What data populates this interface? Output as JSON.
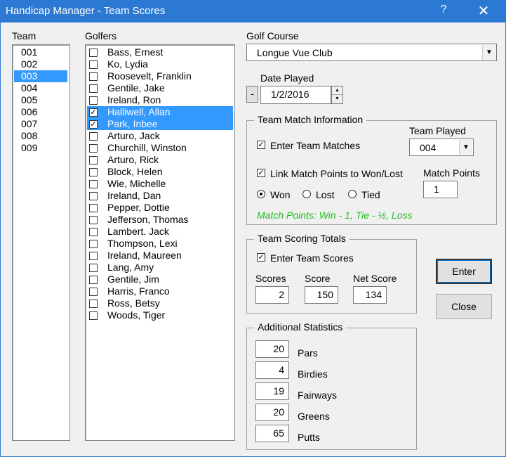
{
  "window": {
    "title": "Handicap Manager - Team Scores",
    "help": "?",
    "close": "✕"
  },
  "team": {
    "label": "Team",
    "items": [
      "001",
      "002",
      "003",
      "004",
      "005",
      "006",
      "007",
      "008",
      "009"
    ],
    "selected": "003"
  },
  "golfers": {
    "label": "Golfers",
    "items": [
      {
        "name": "Bass, Ernest",
        "checked": false
      },
      {
        "name": "Ko, Lydia",
        "checked": false
      },
      {
        "name": "Roosevelt, Franklin",
        "checked": false
      },
      {
        "name": "Gentile, Jake",
        "checked": false
      },
      {
        "name": "Ireland, Ron",
        "checked": false
      },
      {
        "name": "Halliwell, Allan",
        "checked": true
      },
      {
        "name": "Park, Inbee",
        "checked": true
      },
      {
        "name": "Arturo, Jack",
        "checked": false
      },
      {
        "name": "Churchill, Winston",
        "checked": false
      },
      {
        "name": "Arturo, Rick",
        "checked": false
      },
      {
        "name": "Block, Helen",
        "checked": false
      },
      {
        "name": "Wie, Michelle",
        "checked": false
      },
      {
        "name": "Ireland, Dan",
        "checked": false
      },
      {
        "name": "Pepper, Dottie",
        "checked": false
      },
      {
        "name": "Jefferson, Thomas",
        "checked": false
      },
      {
        "name": "Lambert. Jack",
        "checked": false
      },
      {
        "name": "Thompson, Lexi",
        "checked": false
      },
      {
        "name": "Ireland, Maureen",
        "checked": false
      },
      {
        "name": "Lang, Amy",
        "checked": false
      },
      {
        "name": "Gentile, Jim",
        "checked": false
      },
      {
        "name": "Harris, Franco",
        "checked": false
      },
      {
        "name": "Ross, Betsy",
        "checked": false
      },
      {
        "name": "Woods, Tiger",
        "checked": false
      }
    ]
  },
  "golf_course": {
    "label": "Golf Course",
    "value": "Longue Vue Club"
  },
  "date_played": {
    "label": "Date Played",
    "value": "1/2/2016",
    "minus": "-"
  },
  "team_match": {
    "title": "Team Match Information",
    "enter_matches_label": "Enter Team Matches",
    "enter_matches_checked": true,
    "team_played_label": "Team Played",
    "team_played_value": "004",
    "link_points_label": "Link Match Points to Won/Lost",
    "link_points_checked": true,
    "match_points_label": "Match Points",
    "match_points_value": "1",
    "result_options": [
      "Won",
      "Lost",
      "Tied"
    ],
    "result_selected": "Won",
    "note": "Match Points:  Win - 1, Tie - ½, Loss"
  },
  "team_scoring": {
    "title": "Team Scoring Totals",
    "enter_scores_label": "Enter Team Scores",
    "enter_scores_checked": true,
    "scores_label": "Scores",
    "scores_value": "2",
    "score_label": "Score",
    "score_value": "150",
    "net_score_label": "Net Score",
    "net_score_value": "134"
  },
  "additional_stats": {
    "title": "Additional Statistics",
    "rows": [
      {
        "label": "Pars",
        "value": "20"
      },
      {
        "label": "Birdies",
        "value": "4"
      },
      {
        "label": "Fairways",
        "value": "19"
      },
      {
        "label": "Greens",
        "value": "20"
      },
      {
        "label": "Putts",
        "value": "65"
      }
    ]
  },
  "buttons": {
    "enter": "Enter",
    "close": "Close"
  },
  "colors": {
    "titlebar": "#2b79d3",
    "selection": "#3399ff",
    "note": "#1fbf1f"
  }
}
